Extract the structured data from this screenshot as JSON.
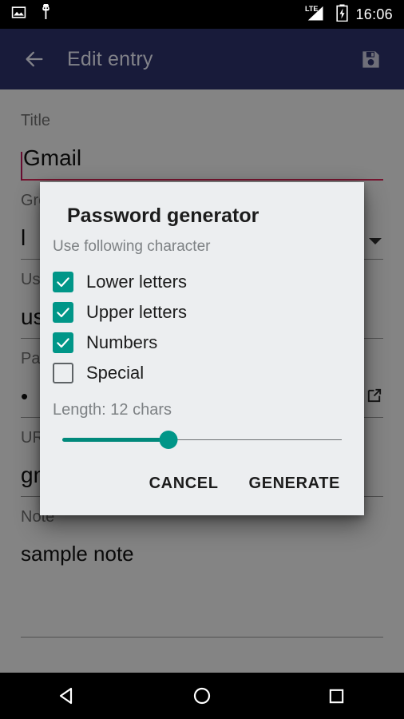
{
  "status_bar": {
    "time": "16:06",
    "network_label": "LTE",
    "icons": [
      "image-icon",
      "android-robot-icon",
      "lte-signal-icon",
      "battery-charging-icon"
    ]
  },
  "app_bar": {
    "title": "Edit entry",
    "back_icon": "back-arrow-icon",
    "save_icon": "save-floppy-icon",
    "background_color": "#232753"
  },
  "form": {
    "fields": [
      {
        "label": "Title",
        "value": "Gmail",
        "focused": true,
        "trailing_icon": ""
      },
      {
        "label": "Group",
        "value": "l",
        "focused": false,
        "trailing_icon": "chevron-down-icon"
      },
      {
        "label": "Username",
        "value": "us",
        "focused": false,
        "trailing_icon": ""
      },
      {
        "label": "Password",
        "value": "•",
        "focused": false,
        "trailing_icon": "external-link-icon"
      },
      {
        "label": "URL",
        "value": "gm",
        "focused": false,
        "trailing_icon": ""
      },
      {
        "label": "Note",
        "value": "sample note",
        "focused": false,
        "trailing_icon": ""
      }
    ]
  },
  "dialog": {
    "title": "Password generator",
    "subtitle": "Use following character",
    "accent_color": "#009688",
    "background_color": "#eceef0",
    "checkboxes": [
      {
        "label": "Lower letters",
        "checked": true
      },
      {
        "label": "Upper letters",
        "checked": true
      },
      {
        "label": "Numbers",
        "checked": true
      },
      {
        "label": "Special",
        "checked": false
      }
    ],
    "length": {
      "label": "Length: 12 chars",
      "value": 12,
      "min": 1,
      "max": 32,
      "percent": 38
    },
    "buttons": {
      "cancel": "CANCEL",
      "generate": "GENERATE"
    }
  },
  "nav_bar": {
    "back": "nav-back-icon",
    "home": "nav-home-icon",
    "recents": "nav-recents-icon"
  }
}
